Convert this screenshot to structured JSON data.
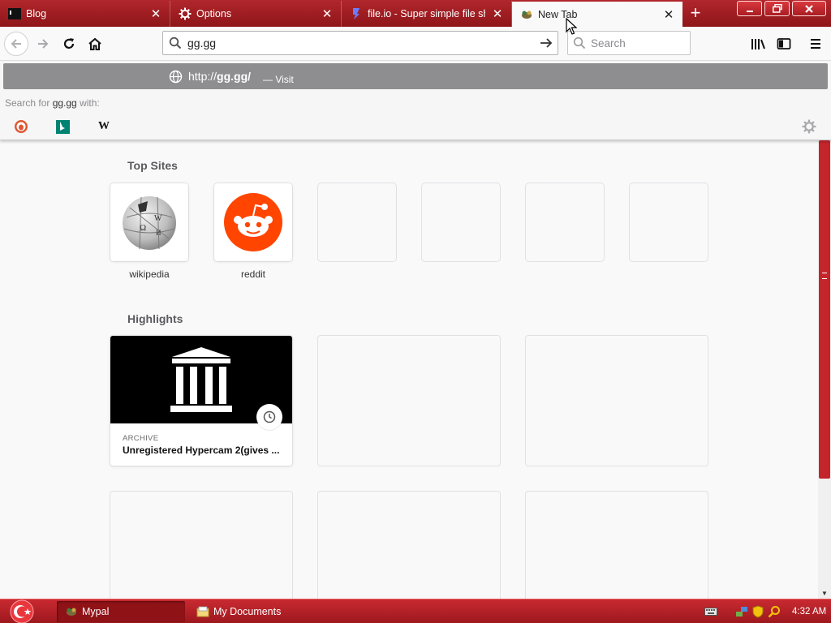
{
  "browser": {
    "tabs": [
      {
        "title": "Blog",
        "icon": "terminal-icon",
        "active": false
      },
      {
        "title": "Options",
        "icon": "gear-icon",
        "active": false
      },
      {
        "title": "file.io - Super simple file sha",
        "icon": "fileio-icon",
        "active": false
      },
      {
        "title": "New Tab",
        "icon": "mypal-icon",
        "active": true
      }
    ],
    "new_tab_label": "+"
  },
  "navbar": {
    "url_value": "gg.gg",
    "search_placeholder": "Search"
  },
  "url_popup": {
    "suggestion": {
      "url_prefix": "http://",
      "url_host": "gg.gg/",
      "action": "— Visit"
    },
    "search_for_prefix": "Search for",
    "search_for_query": "gg.gg",
    "search_for_suffix": "with:",
    "engines": [
      "duckduckgo-icon",
      "bing-icon",
      "wikipedia-icon"
    ]
  },
  "content": {
    "top_sites_title": "Top Sites",
    "top_sites": [
      {
        "label": "wikipedia",
        "icon": "wikipedia-globe-icon"
      },
      {
        "label": "reddit",
        "icon": "reddit-icon"
      },
      {
        "label": "",
        "icon": ""
      },
      {
        "label": "",
        "icon": ""
      },
      {
        "label": "",
        "icon": ""
      },
      {
        "label": "",
        "icon": ""
      }
    ],
    "highlights_title": "Highlights",
    "highlights": [
      {
        "source": "ARCHIVE",
        "title": "Unregistered Hypercam 2(gives ...",
        "icon": "archive-building-icon"
      }
    ]
  },
  "taskbar": {
    "tasks": [
      {
        "label": "Mypal",
        "icon": "mypal-icon",
        "active": true
      },
      {
        "label": "My Documents",
        "icon": "folder-icon",
        "active": false
      }
    ],
    "clock": "4:32 AM"
  },
  "colors": {
    "chrome_red": "#b1272c",
    "taskbar_red": "#c92a31",
    "reddit_orange": "#ff4500",
    "suggestion_gray": "#8e8e91"
  }
}
